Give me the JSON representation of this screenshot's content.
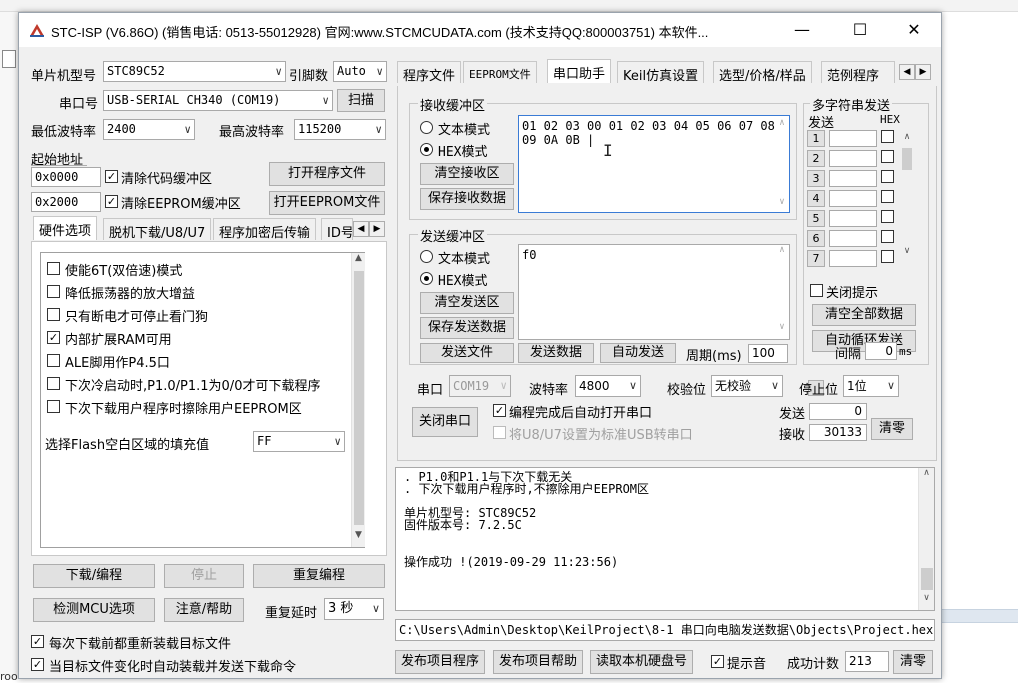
{
  "window": {
    "title": "STC-ISP (V6.86O) (销售电话: 0513-55012928) 官网:www.STCMCUDATA.com  (技术支持QQ:800003751) 本软件...",
    "controls": {
      "minimize": "—",
      "maximize": "☐",
      "close": "✕"
    }
  },
  "left": {
    "mcu_type_label": "单片机型号",
    "mcu_type_value": "STC89C52",
    "pins_label": "引脚数",
    "pins_value": "Auto",
    "port_label": "串口号",
    "port_value": "USB-SERIAL CH340 (COM19)",
    "scan_button": "扫描",
    "min_baud_label": "最低波特率",
    "min_baud_value": "2400",
    "max_baud_label": "最高波特率",
    "max_baud_value": "115200",
    "start_addr_label": "起始地址",
    "addr1_value": "0x0000",
    "clear_code_buffer": "清除代码缓冲区",
    "open_program_file": "打开程序文件",
    "addr2_value": "0x2000",
    "clear_eeprom_buffer": "清除EEPROM缓冲区",
    "open_eeprom_file": "打开EEPROM文件",
    "tabs": [
      "硬件选项",
      "脱机下载/U8/U7",
      "程序加密后传输",
      "ID号"
    ],
    "options": [
      {
        "label": "使能6T(双倍速)模式",
        "checked": false
      },
      {
        "label": "降低振荡器的放大增益",
        "checked": false
      },
      {
        "label": "只有断电才可停止看门狗",
        "checked": false
      },
      {
        "label": "内部扩展RAM可用",
        "checked": true
      },
      {
        "label": "ALE脚用作P4.5口",
        "checked": false
      },
      {
        "label": "下次冷启动时,P1.0/P1.1为0/0才可下载程序",
        "checked": false
      },
      {
        "label": "下次下载用户程序时擦除用户EEPROM区",
        "checked": false
      }
    ],
    "flash_fill_label": "选择Flash空白区域的填充值",
    "flash_fill_value": "FF",
    "download_button": "下载/编程",
    "stop_button": "停止",
    "reprogram_button": "重复编程",
    "check_mcu_button": "检测MCU选项",
    "help_button": "注意/帮助",
    "repeat_delay_label": "重复延时",
    "repeat_delay_value": "3 秒",
    "reload_before_download": "每次下载前都重新装载目标文件",
    "auto_reload_on_change": "当目标文件变化时自动装载并发送下载命令"
  },
  "right": {
    "tabs": [
      "程序文件",
      "EEPROM文件",
      "串口助手",
      "Keil仿真设置",
      "选型/价格/样品",
      "范例程序"
    ],
    "receive": {
      "title": "接收缓冲区",
      "text_mode": "文本模式",
      "hex_mode": "HEX模式",
      "clear_button": "清空接收区",
      "save_button": "保存接收数据",
      "content_line1": "01 02 03 00 01 02 03 04 05 06 07 08",
      "content_line2": "09 0A 0B |"
    },
    "send": {
      "title": "发送缓冲区",
      "text_mode": "文本模式",
      "hex_mode": "HEX模式",
      "clear_button": "清空发送区",
      "save_button": "保存发送数据",
      "content": "f0",
      "send_file_button": "发送文件",
      "send_data_button": "发送数据",
      "auto_send_button": "自动发送",
      "period_label": "周期(ms)",
      "period_value": "100"
    },
    "multi": {
      "title": "多字符串发送",
      "send_col": "发送",
      "hex_col": "HEX",
      "rows": [
        "1",
        "2",
        "3",
        "4",
        "5",
        "6",
        "7"
      ],
      "close_hint": "关闭提示",
      "clear_all_button": "清空全部数据",
      "auto_loop_button": "自动循环发送",
      "interval_label": "间隔",
      "interval_value": "0",
      "interval_unit": "ms"
    },
    "serial": {
      "port_label": "串口",
      "port_value": "COM19",
      "baud_label": "波特率",
      "baud_value": "4800",
      "parity_label": "校验位",
      "parity_value": "无校验",
      "stop_label": "停止位",
      "stop_value": "1位",
      "close_port_button": "关闭串口",
      "auto_open_after_program": "编程完成后自动打开串口",
      "set_u8u7_usb": "将U8/U7设置为标准USB转串口",
      "sent_label": "发送",
      "sent_value": "0",
      "recv_label": "接收",
      "recv_value": "30133",
      "clear_counts_button": "清零"
    },
    "log": {
      "lines": [
        ". P1.0和P1.1与下次下载无关",
        ". 下次下载用户程序时,不擦除用户EEPROM区",
        "",
        "单片机型号: STC89C52",
        "固件版本号: 7.2.5C",
        "",
        "",
        "操作成功 !(2019-09-29 11:23:56)"
      ]
    },
    "path": "C:\\Users\\Admin\\Desktop\\KeilProject\\8-1 串口向电脑发送数据\\Objects\\Project.hex",
    "bottom": {
      "publish_program": "发布项目程序",
      "publish_help": "发布项目帮助",
      "read_disk_id": "读取本机硬盘号",
      "beep": "提示音",
      "success_count_label": "成功计数",
      "success_count_value": "213",
      "clear_button": "清零"
    }
  },
  "background": {
    "left_fragment": "roo"
  },
  "colors": {
    "window_bg": "#f0f0f0",
    "button_bg": "#e1e1e1",
    "tab_active_bg": "#ffffff"
  }
}
